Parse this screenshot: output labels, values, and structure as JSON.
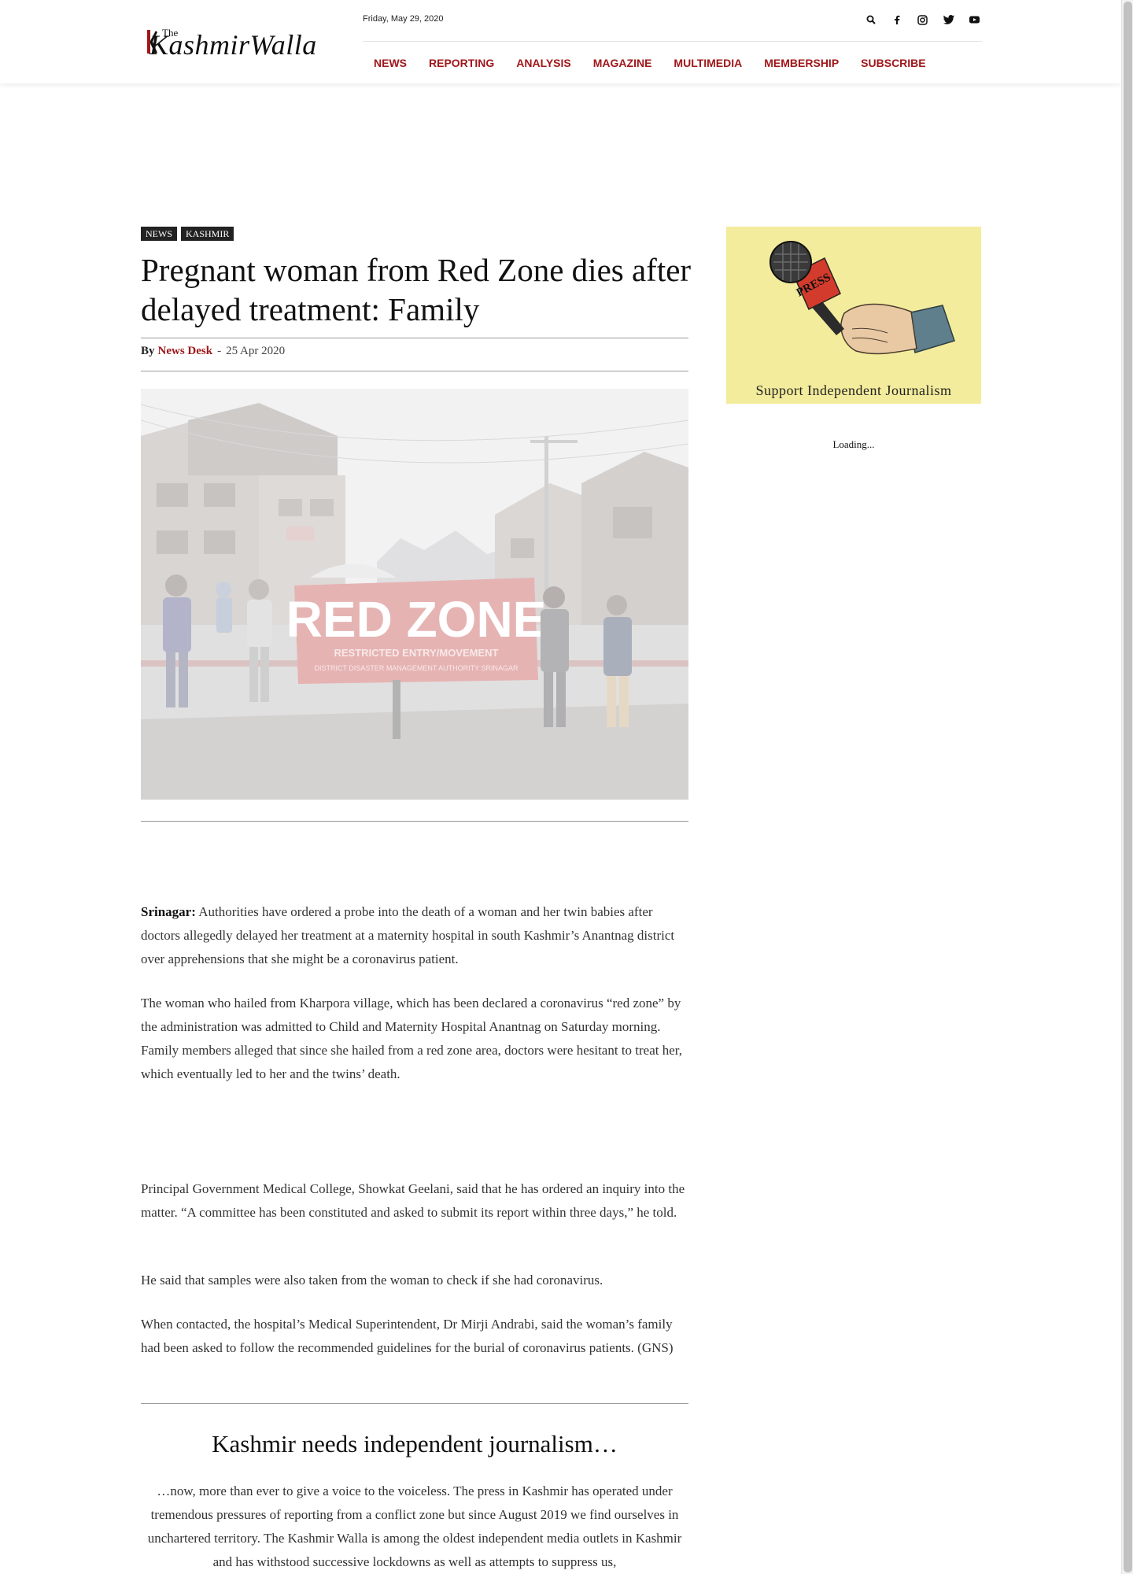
{
  "header": {
    "logo_the": "The",
    "logo_name": "KashmirWalla",
    "date": "Friday, May 29, 2020",
    "icons": [
      "search-icon",
      "facebook-icon",
      "instagram-icon",
      "twitter-icon",
      "youtube-icon"
    ],
    "nav": [
      "NEWS",
      "REPORTING",
      "ANALYSIS",
      "MAGAZINE",
      "MULTIMEDIA",
      "MEMBERSHIP",
      "SUBSCRIBE"
    ]
  },
  "article": {
    "categories": [
      "NEWS",
      "KASHMIR"
    ],
    "title": "Pregnant woman from Red Zone dies after delayed treatment: Family",
    "by_label": "By",
    "author": "News Desk",
    "separator": "-",
    "date": "25 Apr 2020",
    "image_sign_line1": "RED ZONE",
    "image_sign_line2": "RESTRICTED ENTRY/MOVEMENT",
    "image_sign_line3": "DISTRICT DISASTER MANAGEMENT AUTHORITY SRINAGAR",
    "dateline": "Srinagar:",
    "p1": " Authorities have ordered a probe into the death of a woman and her twin babies after doctors allegedly delayed her treatment at a maternity hospital in south Kashmir’s Anantnag district over apprehensions that she might be a coronavirus patient.",
    "p2": "The woman who hailed from Kharpora village, which has been declared a coronavirus “red zone” by the administration was admitted to Child and Maternity Hospital Anantnag on Saturday morning. Family members alleged that since she hailed from a red zone area, doctors were hesitant to treat her, which eventually led to her and the twins’ death.",
    "p3": "Principal Government Medical College, Showkat Geelani, said that he has ordered an inquiry into the matter. “A committee has been constituted and asked to submit its report within three days,” he told.",
    "p4": "He said that samples were also taken from the woman to check if she had coronavirus.",
    "p5": "When contacted, the hospital’s Medical Superintendent, Dr Mirji Andrabi, said the woman’s family had been asked to follow the recommended guidelines for the burial of coronavirus patients. (GNS)"
  },
  "promo": {
    "title": "Kashmir needs independent journalism…",
    "text": "…now, more than ever to give a voice to the voiceless. The press in Kashmir has operated under tremendous pressures of reporting from a conflict zone but since August 2019 we find ourselves in unchartered territory. The Kashmir Walla is among the oldest independent media outlets in Kashmir and has withstood successive lockdowns as well as attempts to suppress us,"
  },
  "sidebar": {
    "ad_mic_label": "PRESS",
    "ad_caption": "Support Independent Journalism",
    "loading": "Loading..."
  },
  "colors": {
    "accent": "#a0171a",
    "ad_background": "#f3ec9c"
  }
}
